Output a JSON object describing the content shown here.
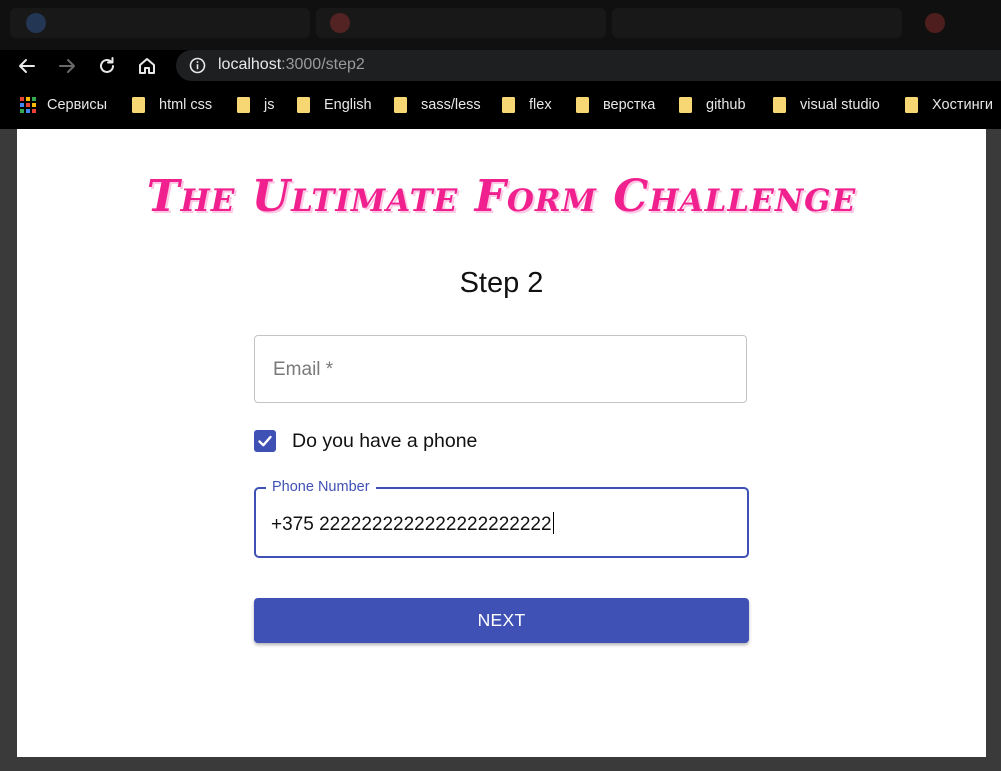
{
  "browser": {
    "url_host": "localhost",
    "url_path": ":3000/step2",
    "bookmarks": [
      {
        "label": "Сервисы",
        "icon": "apps-grid-icon"
      },
      {
        "label": "html css",
        "icon": "folder-icon"
      },
      {
        "label": "js",
        "icon": "folder-icon"
      },
      {
        "label": "English",
        "icon": "folder-icon"
      },
      {
        "label": "sass/less",
        "icon": "folder-icon"
      },
      {
        "label": "flex",
        "icon": "folder-icon"
      },
      {
        "label": "верстка",
        "icon": "folder-icon"
      },
      {
        "label": "github",
        "icon": "folder-icon"
      },
      {
        "label": "visual studio",
        "icon": "folder-icon"
      },
      {
        "label": "Хостинги",
        "icon": "folder-icon"
      }
    ]
  },
  "page": {
    "title": "The Ultimate Form Challenge",
    "step_heading": "Step 2",
    "email": {
      "placeholder": "Email *",
      "value": ""
    },
    "phone_checkbox": {
      "label": "Do you have a phone",
      "checked": true
    },
    "phone": {
      "label": "Phone Number",
      "value": "+375 2222222222222222222222"
    },
    "next_button": "NEXT"
  },
  "colors": {
    "title": "#f0208f",
    "primary": "#3f51b5"
  }
}
